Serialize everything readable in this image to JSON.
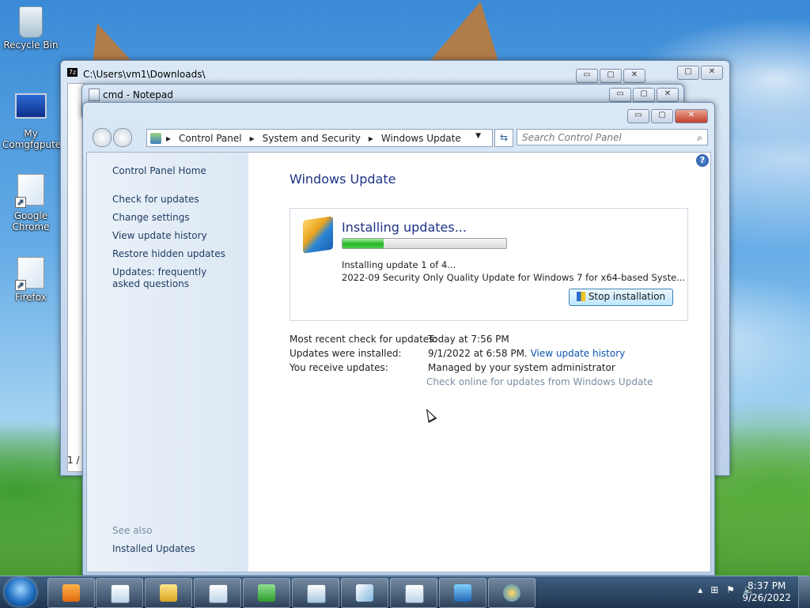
{
  "desktop": {
    "icons": [
      {
        "label": "Recycle Bin",
        "icon": "recycle-bin-icon"
      },
      {
        "label": "My Comgfgputer",
        "icon": "computer-icon"
      },
      {
        "label": "Google Chrome",
        "icon": "shortcut-icon"
      },
      {
        "label": "Firefox",
        "icon": "shortcut-icon"
      }
    ]
  },
  "background_windows": {
    "sevenzip_title": "C:\\Users\\vm1\\Downloads\\",
    "notepad_title": "cmd - Notepad",
    "sevenzip_status": "1 /"
  },
  "window": {
    "minimize": "▭",
    "maximize": "▢",
    "close": "✕"
  },
  "address": {
    "crumbs": [
      "Control Panel",
      "System and Security",
      "Windows Update"
    ],
    "search_placeholder": "Search Control Panel"
  },
  "sidebar": {
    "home": "Control Panel Home",
    "links": [
      "Check for updates",
      "Change settings",
      "View update history",
      "Restore hidden updates",
      "Updates: frequently asked questions"
    ],
    "see_also": "See also",
    "installed": "Installed Updates"
  },
  "main": {
    "title": "Windows Update",
    "status_title": "Installing updates...",
    "progress": 0.25,
    "installing_line": "Installing update 1 of 4...",
    "update_name": "2022-09 Security Only Quality Update for Windows 7 for x64-based Syste...",
    "stop_button": "Stop installation",
    "info": [
      {
        "label": "Most recent check for updates:",
        "value": "Today at 7:56 PM"
      },
      {
        "label": "Updates were installed:",
        "value": "9/1/2022 at 6:58 PM.",
        "link": "View update history"
      },
      {
        "label": "You receive updates:",
        "value": "Managed by your system administrator"
      }
    ],
    "check_online": "Check online for updates from Windows Update"
  },
  "taskbar": {
    "time": "8:37 PM",
    "date": "9/26/2022"
  }
}
